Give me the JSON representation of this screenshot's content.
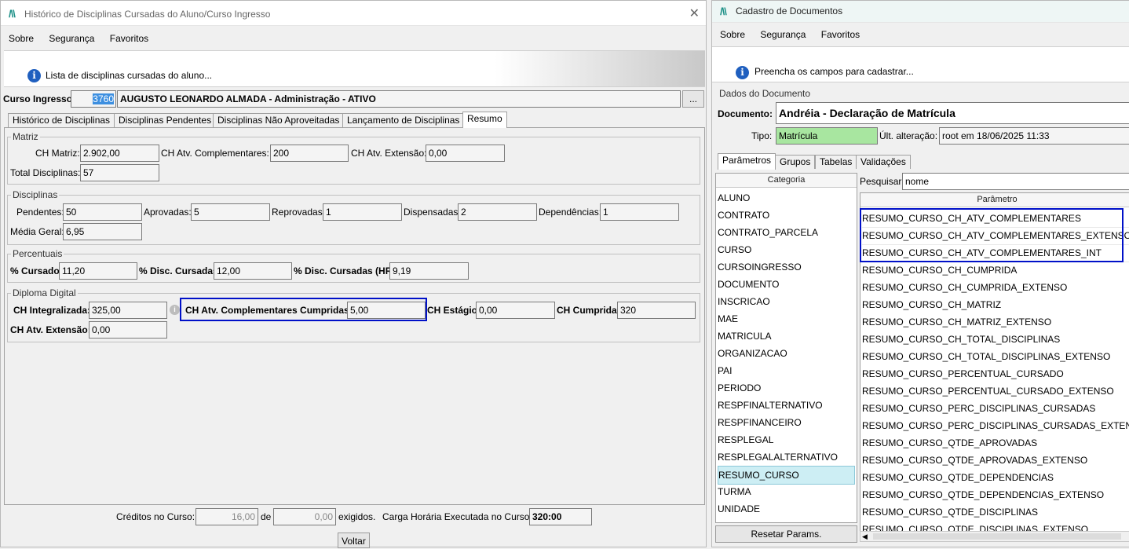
{
  "left": {
    "title": "Histórico de Disciplinas Cursadas do Aluno/Curso Ingresso",
    "menu": [
      "Sobre",
      "Segurança",
      "Favoritos"
    ],
    "message": "Lista de disciplinas cursadas do aluno...",
    "curso_label": "Curso Ingresso:",
    "curso_code": "3760",
    "curso_name": "AUGUSTO LEONARDO ALMADA - Administração - ATIVO",
    "browse_label": "...",
    "tabs": [
      "Histórico de Disciplinas",
      "Disciplinas Pendentes",
      "Disciplinas Não Aproveitadas",
      "Lançamento de Disciplinas",
      "Resumo"
    ],
    "matriz": {
      "title": "Matriz",
      "ch_matriz_label": "CH Matriz:",
      "ch_matriz": "2.902,00",
      "ch_atv_comp_label": "CH Atv. Complementares:",
      "ch_atv_comp": "200",
      "ch_atv_ext_label": "CH Atv. Extensão:",
      "ch_atv_ext": "0,00",
      "total_label": "Total Disciplinas:",
      "total": "57"
    },
    "disciplinas": {
      "title": "Disciplinas",
      "pendentes_label": "Pendentes:",
      "pendentes": "50",
      "aprovadas_label": "Aprovadas:",
      "aprovadas": "5",
      "reprovadas_label": "Reprovadas:",
      "reprovadas": "1",
      "dispensadas_label": "Dispensadas:",
      "dispensadas": "2",
      "dependencias_label": "Dependências:",
      "dependencias": "1",
      "media_label": "Média Geral:",
      "media": "6,95"
    },
    "percentuais": {
      "title": "Percentuais",
      "cursado_label": "% Cursado:",
      "cursado": "11,20",
      "disc_label": "% Disc. Cursadas:",
      "disc": "12,00",
      "disc_hr_label": "% Disc. Cursadas (HR):",
      "disc_hr": "9,19"
    },
    "diploma": {
      "title": "Diploma Digital",
      "ch_int_label": "CH Integralizada:",
      "ch_int": "325,00",
      "ch_acc_label": "CH Atv. Complementares Cumpridas:",
      "ch_acc": "5,00",
      "ch_est_label": "CH Estágio:",
      "ch_est": "0,00",
      "ch_cump_label": "CH Cumprida:",
      "ch_cump": "320",
      "ch_ext_label": "CH Atv. Extensão:",
      "ch_ext": "0,00"
    },
    "footer": {
      "creditos_label": "Créditos no Curso:",
      "creditos": "16,00",
      "de_label": "de",
      "exigidos": "0,00",
      "exigidos_label": "exigidos.",
      "carga_label": "Carga Horária Executada no Curso:",
      "carga": "320:00",
      "voltar": "Voltar"
    }
  },
  "right": {
    "title": "Cadastro de Documentos",
    "menu": [
      "Sobre",
      "Segurança",
      "Favoritos"
    ],
    "message": "Preencha os campos para cadastrar...",
    "dados_title": "Dados do Documento",
    "documento_label": "Documento:",
    "documento": "Andréia - Declaração de Matrícula",
    "tipo_label": "Tipo:",
    "tipo": "Matrícula",
    "ult_label": "Últ. alteração:",
    "ult": "root em 18/06/2025 11:33",
    "tabs": [
      "Parâmetros",
      "Grupos",
      "Tabelas",
      "Validações"
    ],
    "categoria_header": "Categoria",
    "categorias": [
      "ALUNO",
      "CONTRATO",
      "CONTRATO_PARCELA",
      "CURSO",
      "CURSOINGRESSO",
      "DOCUMENTO",
      "INSCRICAO",
      "MAE",
      "MATRICULA",
      "ORGANIZACAO",
      "PAI",
      "PERIODO",
      "RESPFINALTERNATIVO",
      "RESPFINANCEIRO",
      "RESPLEGAL",
      "RESPLEGALALTERNATIVO",
      "RESUMO_CURSO",
      "TURMA",
      "UNIDADE"
    ],
    "selected_categoria": "RESUMO_CURSO",
    "pesquisar_label": "Pesquisar:",
    "pesquisar": "nome",
    "parametro_header": "Parâmetro",
    "parametros": [
      "RESUMO_CURSO_CH_ATV_COMPLEMENTARES",
      "RESUMO_CURSO_CH_ATV_COMPLEMENTARES_EXTENSO",
      "RESUMO_CURSO_CH_ATV_COMPLEMENTARES_INT",
      "RESUMO_CURSO_CH_CUMPRIDA",
      "RESUMO_CURSO_CH_CUMPRIDA_EXTENSO",
      "RESUMO_CURSO_CH_MATRIZ",
      "RESUMO_CURSO_CH_MATRIZ_EXTENSO",
      "RESUMO_CURSO_CH_TOTAL_DISCIPLINAS",
      "RESUMO_CURSO_CH_TOTAL_DISCIPLINAS_EXTENSO",
      "RESUMO_CURSO_PERCENTUAL_CURSADO",
      "RESUMO_CURSO_PERCENTUAL_CURSADO_EXTENSO",
      "RESUMO_CURSO_PERC_DISCIPLINAS_CURSADAS",
      "RESUMO_CURSO_PERC_DISCIPLINAS_CURSADAS_EXTENSO",
      "RESUMO_CURSO_QTDE_APROVADAS",
      "RESUMO_CURSO_QTDE_APROVADAS_EXTENSO",
      "RESUMO_CURSO_QTDE_DEPENDENCIAS",
      "RESUMO_CURSO_QTDE_DEPENDENCIAS_EXTENSO",
      "RESUMO_CURSO_QTDE_DISCIPLINAS",
      "RESUMO_CURSO_QTDE_DISCIPLINAS_EXTENSO"
    ],
    "resetar": "Resetar Params."
  },
  "colors": {
    "highlight": "#0010c8",
    "tipo_bg": "#a8e6a0",
    "selected_row": "#cdeef4",
    "logo": "#1a8f86",
    "info": "#1f5fbf"
  }
}
